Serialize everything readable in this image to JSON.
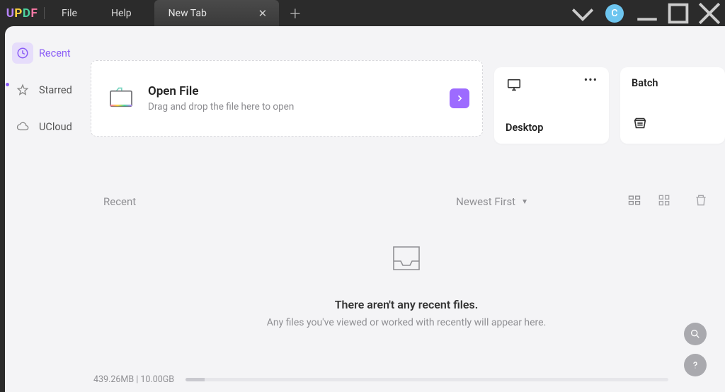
{
  "titlebar": {
    "logo_letters": [
      "U",
      "P",
      "D",
      "F"
    ],
    "menu": {
      "file": "File",
      "help": "Help"
    },
    "tab_label": "New Tab",
    "avatar_initial": "C"
  },
  "sidebar": {
    "items": [
      {
        "label": "Recent"
      },
      {
        "label": "Starred"
      },
      {
        "label": "UCloud"
      }
    ]
  },
  "cards": {
    "open": {
      "title": "Open File",
      "subtitle": "Drag and drop the file here to open"
    },
    "desktop": {
      "label": "Desktop"
    },
    "batch": {
      "label": "Batch"
    }
  },
  "recent": {
    "title": "Recent",
    "sort_label": "Newest First"
  },
  "empty": {
    "headline": "There aren't any recent files.",
    "sub": "Any files you've viewed or worked with recently will appear here."
  },
  "footer": {
    "storage": "439.26MB | 10.00GB"
  }
}
